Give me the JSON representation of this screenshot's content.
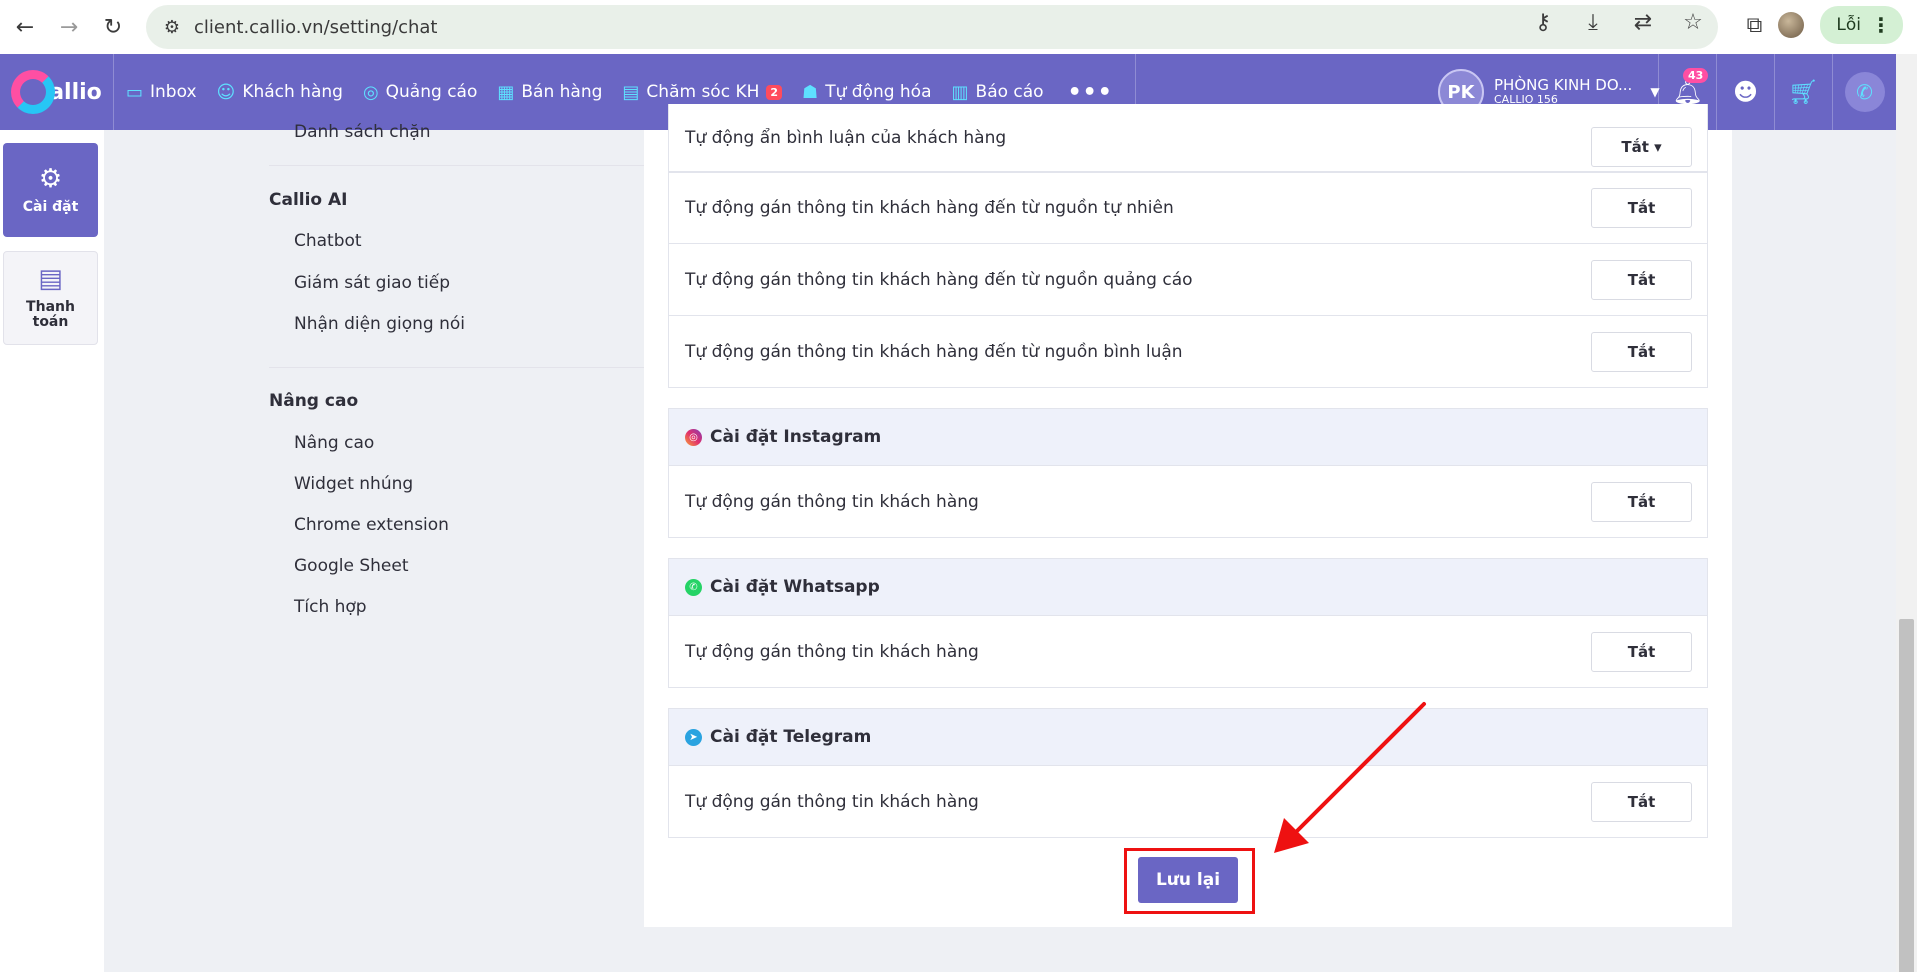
{
  "browser": {
    "url": "client.callio.vn/setting/chat",
    "error_label": "Lỗi"
  },
  "app": {
    "logo_text": "allio",
    "menu": [
      {
        "label": "Inbox",
        "icon": "inbox-icon"
      },
      {
        "label": "Khách hàng",
        "icon": "customer-icon"
      },
      {
        "label": "Quảng cáo",
        "icon": "ads-icon"
      },
      {
        "label": "Bán hàng",
        "icon": "sales-icon"
      },
      {
        "label": "Chăm sóc KH",
        "icon": "care-icon",
        "badge": "2"
      },
      {
        "label": "Tự động hóa",
        "icon": "robot-icon"
      },
      {
        "label": "Báo cáo",
        "icon": "report-icon"
      }
    ],
    "more": "•••",
    "account": {
      "initials": "PK",
      "name": "PHÒNG KINH DO...",
      "sub": "CALLIO 156"
    },
    "notifications_count": "43"
  },
  "rail": {
    "settings_label": "Cài đặt",
    "billing_label": "Thanh toán"
  },
  "settings_nav": {
    "blocked_list": "Danh sách chặn",
    "callio_ai_head": "Callio AI",
    "chatbot": "Chatbot",
    "monitor": "Giám sát giao tiếp",
    "voice": "Nhận diện giọng nói",
    "advanced_head": "Nâng cao",
    "advanced": "Nâng cao",
    "widget": "Widget nhúng",
    "chrome_ext": "Chrome extension",
    "google_sheet": "Google Sheet",
    "integration": "Tích hợp"
  },
  "panel": {
    "facebook_rows": [
      {
        "label": "Tự động ẩn bình luận của khách hàng",
        "value": "Tắt ▾"
      },
      {
        "label": "Tự động gán thông tin khách hàng đến từ nguồn tự nhiên",
        "value": "Tắt"
      },
      {
        "label": "Tự động gán thông tin khách hàng đến từ nguồn quảng cáo",
        "value": "Tắt"
      },
      {
        "label": "Tự động gán thông tin khách hàng đến từ nguồn bình luận",
        "value": "Tắt"
      }
    ],
    "instagram": {
      "title": "Cài đặt Instagram",
      "row_label": "Tự động gán thông tin khách hàng",
      "value": "Tắt"
    },
    "whatsapp": {
      "title": "Cài đặt Whatsapp",
      "row_label": "Tự động gán thông tin khách hàng",
      "value": "Tắt"
    },
    "telegram": {
      "title": "Cài đặt Telegram",
      "row_label": "Tự động gán thông tin khách hàng",
      "value": "Tắt"
    },
    "save_label": "Lưu lại"
  },
  "colors": {
    "brand": "#6a66c4",
    "annotation": "#ee1111"
  }
}
